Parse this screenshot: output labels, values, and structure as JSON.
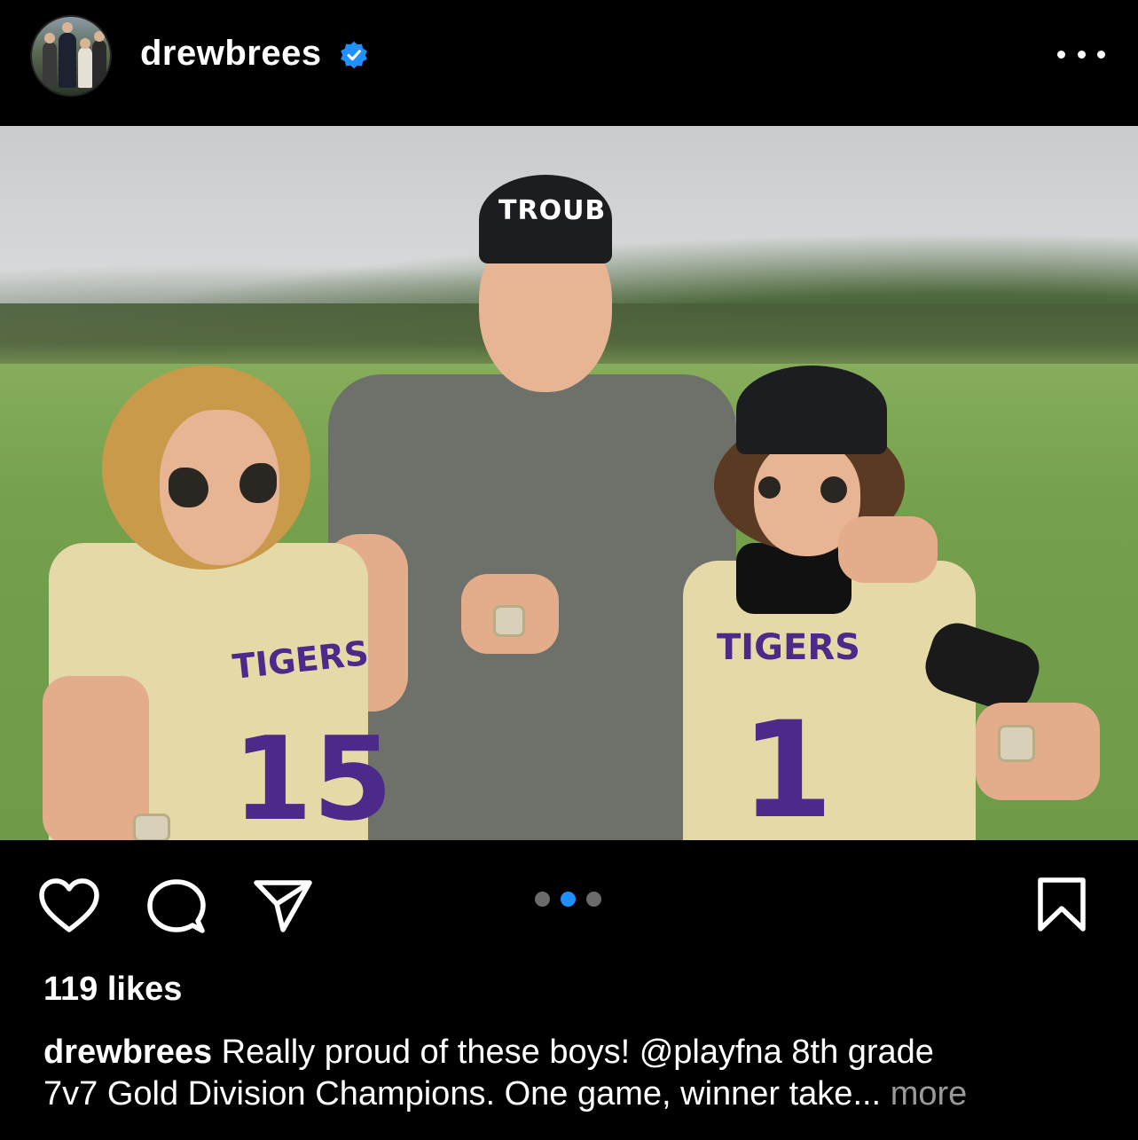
{
  "post": {
    "username": "drewbrees",
    "verified": true,
    "likes_text": "119 likes",
    "caption": {
      "username": "drewbrees",
      "text_line1": "Really proud of these boys! @playfna 8th grade",
      "text_line2": "7v7 Gold Division Champions. One game, winner take...",
      "more_label": "more"
    },
    "photo": {
      "cap_text": "TROUB",
      "left_jersey_text": "TIGERS",
      "left_jersey_number": "15",
      "right_jersey_text": "TIGERS",
      "right_jersey_number": "1"
    },
    "carousel": {
      "count": 3,
      "active_index": 1
    }
  },
  "icons": {
    "avatar": "profile-avatar",
    "verified": "verified-badge-icon",
    "more": "more-options-icon",
    "like": "heart-icon",
    "comment": "comment-bubble-icon",
    "share": "paper-plane-icon",
    "save": "bookmark-icon"
  },
  "colors": {
    "background": "#000000",
    "text": "#ffffff",
    "verified_blue": "#1e90ff",
    "carousel_active": "#1e90ff",
    "carousel_inactive": "#6b6b6b",
    "more_link": "#9a9a9a"
  }
}
